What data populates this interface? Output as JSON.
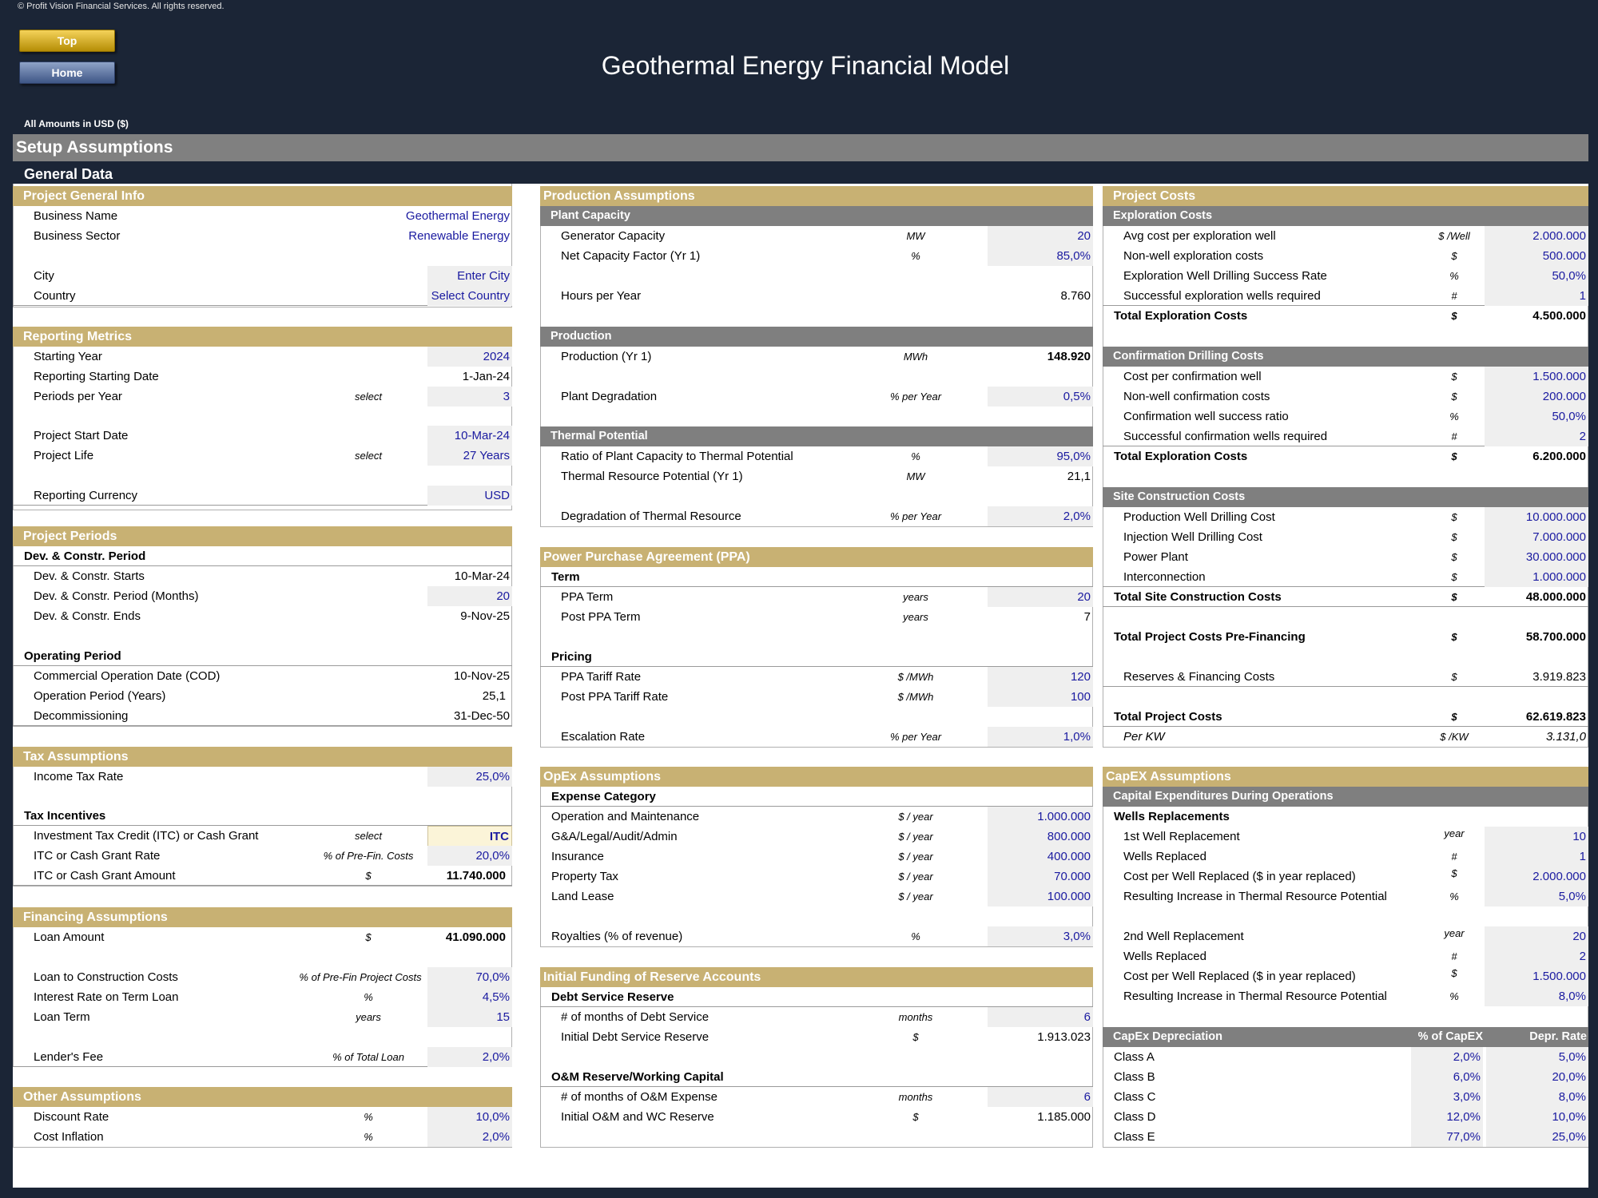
{
  "copyright": "© Profit Vision Financial Services. All rights reserved.",
  "nav": {
    "top_label": "Top",
    "home_label": "Home"
  },
  "title": "Geothermal Energy Financial Model",
  "amounts_label": "All Amounts in  USD ($)",
  "setup_label": "Setup Assumptions",
  "general_label": "General Data",
  "project_info": {
    "title": "Project General Info",
    "business_name": {
      "label": "Business Name",
      "value": "Geothermal Energy"
    },
    "business_sector": {
      "label": "Business Sector",
      "value": "Renewable Energy"
    },
    "city": {
      "label": "City",
      "value": "Enter City"
    },
    "country": {
      "label": "Country",
      "value": "Select Country"
    }
  },
  "reporting": {
    "title": "Reporting Metrics",
    "starting_year": {
      "label": "Starting Year",
      "value": "2024"
    },
    "reporting_start": {
      "label": "Reporting Starting Date",
      "value": "1-Jan-24"
    },
    "periods_per_year": {
      "label": "Periods per Year",
      "unit": "select",
      "value": "3"
    },
    "project_start": {
      "label": "Project Start Date",
      "value": "10-Mar-24"
    },
    "project_life": {
      "label": "Project Life",
      "unit": "select",
      "value": "27 Years"
    },
    "currency": {
      "label": "Reporting Currency",
      "value": "USD"
    }
  },
  "periods": {
    "title": "Project Periods",
    "dev_title": "Dev. & Constr. Period",
    "dev_starts": {
      "label": "Dev. & Constr. Starts",
      "value": "10-Mar-24"
    },
    "dev_months": {
      "label": "Dev. & Constr. Period (Months)",
      "value": "20"
    },
    "dev_ends": {
      "label": "Dev. & Constr. Ends",
      "value": "9-Nov-25"
    },
    "op_title": "Operating Period",
    "cod": {
      "label": "Commercial Operation Date (COD)",
      "value": "10-Nov-25"
    },
    "op_years": {
      "label": "Operation Period (Years)",
      "value": "25,1"
    },
    "decom": {
      "label": "Decommissioning",
      "value": "31-Dec-50"
    }
  },
  "tax": {
    "title": "Tax Assumptions",
    "income_tax": {
      "label": "Income Tax Rate",
      "value": "25,0%"
    },
    "incentives_title": "Tax Incentives",
    "itc": {
      "label": "Investment Tax Credit (ITC) or Cash Grant",
      "unit": "select",
      "value": "ITC"
    },
    "itc_rate": {
      "label": "ITC or Cash Grant Rate",
      "unit": "% of Pre-Fin. Costs",
      "value": "20,0%"
    },
    "itc_amount": {
      "label": "ITC or Cash Grant Amount",
      "unit": "$",
      "value": "11.740.000"
    }
  },
  "financing": {
    "title": "Financing Assumptions",
    "loan_amount": {
      "label": "Loan Amount",
      "unit": "$",
      "value": "41.090.000"
    },
    "ltc": {
      "label": "Loan to Construction Costs",
      "unit": "% of Pre-Fin Project Costs",
      "value": "70,0%"
    },
    "interest": {
      "label": "Interest Rate on Term Loan",
      "unit": "%",
      "value": "4,5%"
    },
    "term": {
      "label": "Loan Term",
      "unit": "years",
      "value": "15"
    },
    "fee": {
      "label": "Lender's Fee",
      "unit": "% of Total Loan",
      "value": "2,0%"
    }
  },
  "other": {
    "title": "Other Assumptions",
    "discount": {
      "label": "Discount Rate",
      "unit": "%",
      "value": "10,0%"
    },
    "inflation": {
      "label": "Cost Inflation",
      "unit": "%",
      "value": "2,0%"
    }
  },
  "production": {
    "title": "Production Assumptions",
    "capacity_title": "Plant Capacity",
    "gen_capacity": {
      "label": "Generator Capacity",
      "unit": "MW",
      "value": "20"
    },
    "capacity_factor": {
      "label": "Net Capacity Factor (Yr 1)",
      "unit": "%",
      "value": "85,0%"
    },
    "hours": {
      "label": "Hours per Year",
      "value": "8.760"
    },
    "production_title": "Production",
    "production_yr1": {
      "label": "Production (Yr 1)",
      "unit": "MWh",
      "value": "148.920"
    },
    "degradation": {
      "label": "Plant Degradation",
      "unit": "% per Year",
      "value": "0,5%"
    },
    "thermal_title": "Thermal Potential",
    "ratio": {
      "label": "Ratio of Plant Capacity to Thermal Potential",
      "unit": "%",
      "value": "95,0%"
    },
    "thermal_potential": {
      "label": "Thermal Resource Potential (Yr 1)",
      "unit": "MW",
      "value": "21,1"
    },
    "thermal_degradation": {
      "label": "Degradation of Thermal Resource",
      "unit": "% per Year",
      "value": "2,0%"
    }
  },
  "ppa": {
    "title": "Power Purchase Agreement (PPA)",
    "term_title": "Term",
    "ppa_term": {
      "label": "PPA Term",
      "unit": "years",
      "value": "20"
    },
    "post_term": {
      "label": "Post PPA Term",
      "unit": "years",
      "value": "7"
    },
    "pricing_title": "Pricing",
    "tariff": {
      "label": "PPA Tariff Rate",
      "unit": "$ /MWh",
      "value": "120"
    },
    "post_tariff": {
      "label": "Post PPA Tariff Rate",
      "unit": "$ /MWh",
      "value": "100"
    },
    "escalation": {
      "label": "Escalation Rate",
      "unit": "% per Year",
      "value": "1,0%"
    }
  },
  "opex": {
    "title": "OpEx Assumptions",
    "category_title": "Expense Category",
    "om": {
      "label": "Operation and Maintenance",
      "unit": "$ / year",
      "value": "1.000.000"
    },
    "ga": {
      "label": "G&A/Legal/Audit/Admin",
      "unit": "$ / year",
      "value": "800.000"
    },
    "insurance": {
      "label": "Insurance",
      "unit": "$ / year",
      "value": "400.000"
    },
    "property_tax": {
      "label": "Property Tax",
      "unit": "$ / year",
      "value": "70.000"
    },
    "land_lease": {
      "label": "Land Lease",
      "unit": "$ / year",
      "value": "100.000"
    },
    "royalties": {
      "label": "Royalties (% of revenue)",
      "unit": "%",
      "value": "3,0%"
    }
  },
  "reserves": {
    "title": "Initial Funding of Reserve Accounts",
    "debt_title": "Debt Service Reserve",
    "debt_months": {
      "label": "# of months of Debt Service",
      "unit": "months",
      "value": "6"
    },
    "debt_reserve": {
      "label": "Initial Debt Service Reserve",
      "unit": "$",
      "value": "1.913.023"
    },
    "om_title": "O&M Reserve/Working Capital",
    "om_months": {
      "label": "# of months of O&M Expense",
      "unit": "months",
      "value": "6"
    },
    "om_reserve": {
      "label": "Initial O&M and WC Reserve",
      "unit": "$",
      "value": "1.185.000"
    }
  },
  "costs": {
    "title": "Project Costs",
    "exploration_title": "Exploration Costs",
    "avg_exploration": {
      "label": "Avg cost per exploration well",
      "unit": "$ /Well",
      "value": "2.000.000"
    },
    "nonwell_exploration": {
      "label": "Non-well exploration costs",
      "unit": "$",
      "value": "500.000"
    },
    "exploration_success": {
      "label": "Exploration Well Drilling Success Rate",
      "unit": "%",
      "value": "50,0%"
    },
    "exploration_wells": {
      "label": "Successful exploration wells required",
      "unit": "#",
      "value": "1"
    },
    "total_exploration": {
      "label": "Total Exploration Costs",
      "unit": "$",
      "value": "4.500.000"
    },
    "confirmation_title": "Confirmation Drilling Costs",
    "cost_confirmation": {
      "label": "Cost per confirmation well",
      "unit": "$",
      "value": "1.500.000"
    },
    "nonwell_confirmation": {
      "label": "Non-well confirmation costs",
      "unit": "$",
      "value": "200.000"
    },
    "confirmation_success": {
      "label": "Confirmation well success ratio",
      "unit": "%",
      "value": "50,0%"
    },
    "confirmation_wells": {
      "label": "Successful confirmation wells required",
      "unit": "#",
      "value": "2"
    },
    "total_confirmation": {
      "label": "Total Exploration Costs",
      "unit": "$",
      "value": "6.200.000"
    },
    "site_title": "Site Construction Costs",
    "production_well": {
      "label": "Production Well Drilling Cost",
      "unit": "$",
      "value": "10.000.000"
    },
    "injection_well": {
      "label": "Injection Well Drilling Cost",
      "unit": "$",
      "value": "7.000.000"
    },
    "power_plant": {
      "label": "Power Plant",
      "unit": "$",
      "value": "30.000.000"
    },
    "interconnection": {
      "label": "Interconnection",
      "unit": "$",
      "value": "1.000.000"
    },
    "total_site": {
      "label": "Total Site Construction Costs",
      "unit": "$",
      "value": "48.000.000"
    },
    "total_prefin": {
      "label": "Total Project Costs Pre-Financing",
      "unit": "$",
      "value": "58.700.000"
    },
    "reserves_fin": {
      "label": "Reserves & Financing Costs",
      "unit": "$",
      "value": "3.919.823"
    },
    "total": {
      "label": "Total Project Costs",
      "unit": "$",
      "value": "62.619.823"
    },
    "per_kw": {
      "label": "Per KW",
      "unit": "$ /KW",
      "value": "3.131,0"
    }
  },
  "capex": {
    "title": "CapEX Assumptions",
    "during_ops_title": "Capital Expenditures During Operations",
    "wells_title": "Wells Replacements",
    "first_repl": {
      "label": "1st Well Replacement",
      "unit": "year",
      "value": "10"
    },
    "wells_repl1": {
      "label": "Wells Replaced",
      "unit": "#",
      "value": "1"
    },
    "cost_repl1": {
      "label": "Cost per Well Replaced  ($ in year replaced)",
      "unit": "$",
      "value": "2.000.000"
    },
    "increase1": {
      "label": "Resulting Increase in Thermal Resource Potential",
      "unit": "%",
      "value": "5,0%"
    },
    "second_repl": {
      "label": "2nd Well Replacement",
      "unit": "year",
      "value": "20"
    },
    "wells_repl2": {
      "label": "Wells Replaced",
      "unit": "#",
      "value": "2"
    },
    "cost_repl2": {
      "label": "Cost per Well Replaced  ($ in year replaced)",
      "unit": "$",
      "value": "1.500.000"
    },
    "increase2": {
      "label": "Resulting Increase in Thermal Resource Potential",
      "unit": "%",
      "value": "8,0%"
    },
    "depreciation_title": "CapEx Depreciation",
    "pct_header": "% of CapEX",
    "rate_header": "Depr. Rate",
    "classes": [
      {
        "name": "Class A",
        "pct": "2,0%",
        "rate": "5,0%"
      },
      {
        "name": "Class B",
        "pct": "6,0%",
        "rate": "20,0%"
      },
      {
        "name": "Class C",
        "pct": "3,0%",
        "rate": "8,0%"
      },
      {
        "name": "Class D",
        "pct": "12,0%",
        "rate": "10,0%"
      },
      {
        "name": "Class E",
        "pct": "77,0%",
        "rate": "25,0%"
      }
    ]
  }
}
